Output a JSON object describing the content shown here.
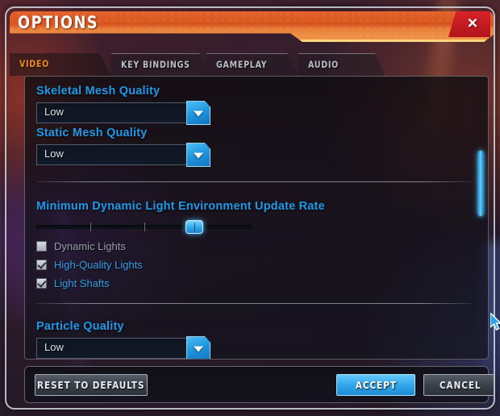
{
  "window": {
    "title": "OPTIONS",
    "close_icon": "close-icon",
    "close_label": "✕"
  },
  "tabs": [
    {
      "label": "VIDEO",
      "active": true
    },
    {
      "label": "KEY BINDINGS",
      "active": false
    },
    {
      "label": "GAMEPLAY",
      "active": false
    },
    {
      "label": "AUDIO",
      "active": false
    }
  ],
  "settings": {
    "skeletal_mesh_quality": {
      "label": "Skeletal Mesh Quality",
      "value": "Low",
      "arrow_icon": "chevron-down-icon"
    },
    "static_mesh_quality": {
      "label": "Static Mesh Quality",
      "value": "Low",
      "arrow_icon": "chevron-down-icon"
    },
    "min_dynamic_light_update_rate": {
      "label": "Minimum Dynamic Light Environment Update Rate",
      "percent": 73
    },
    "checkboxes": [
      {
        "label": "Dynamic Lights",
        "checked": false
      },
      {
        "label": "High-Quality Lights",
        "checked": true
      },
      {
        "label": "Light Shafts",
        "checked": true
      }
    ],
    "particle_quality": {
      "label": "Particle Quality",
      "value": "Low",
      "arrow_icon": "chevron-down-icon"
    }
  },
  "scrollbar": {
    "thumb_top_percent": 26,
    "thumb_height_percent": 23
  },
  "footer": {
    "reset_label": "RESET TO DEFAULTS",
    "accept_label": "ACCEPT",
    "cancel_label": "CANCEL"
  },
  "colors": {
    "title_bar": "#d9551f",
    "accent_blue": "#1e9ae8",
    "close_red": "#c8191f",
    "tab_active_text": "#f08a22",
    "disabled_text": "#9aa0aa"
  }
}
